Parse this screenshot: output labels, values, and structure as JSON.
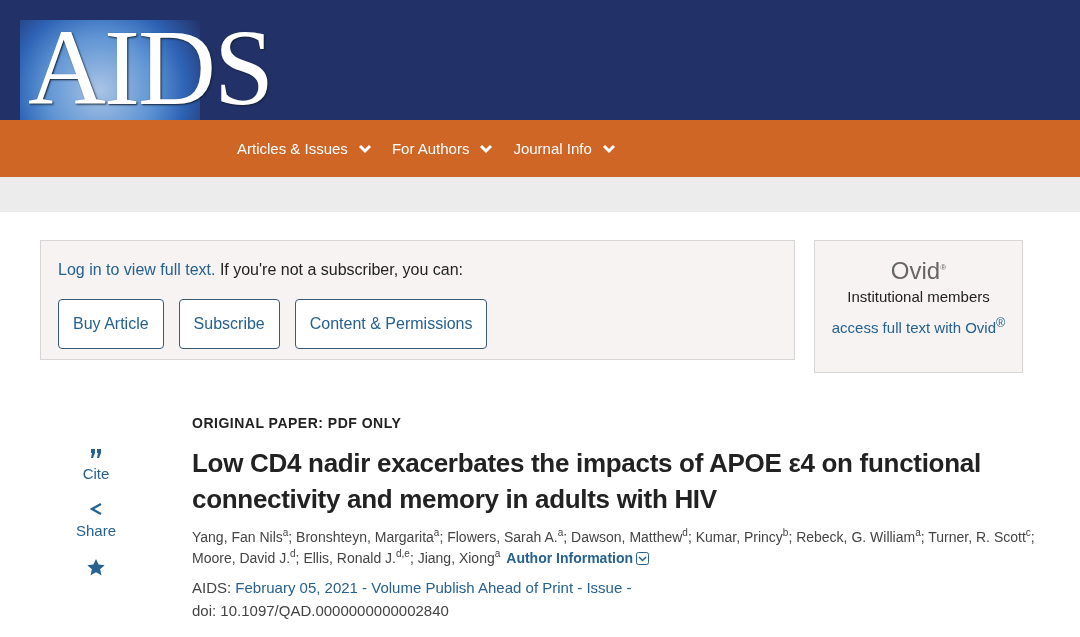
{
  "header": {
    "logo": "AIDS"
  },
  "nav": [
    {
      "label": "Articles & Issues"
    },
    {
      "label": "For Authors"
    },
    {
      "label": "Journal Info"
    }
  ],
  "access": {
    "login_link": "Log in to view full text.",
    "text": "If you're not a subscriber, you can:",
    "buttons": [
      "Buy Article",
      "Subscribe",
      "Content & Permissions"
    ]
  },
  "ovid": {
    "logo": "Ovid",
    "logo_mark": "®",
    "text": "Institutional members",
    "link": "access full text with Ovid$^{®}$"
  },
  "sidebar": [
    {
      "kind": "quote",
      "label": "Cite"
    },
    {
      "kind": "share",
      "label": "Share"
    },
    {
      "kind": "star"
    }
  ],
  "article": {
    "category": "ORIGINAL PAPER: PDF ONLY",
    "title": "Low CD4 nadir exacerbates the impacts of APOE ε4 on functional connectivity and memory in adults with HIV",
    "authors": "Yang, Fan Nils$^{a}$; Bronshteyn, Margarita$^{a}$; Flowers, Sarah A.$^{a}$; Dawson, Matthew$^{d}$; Kumar, Princy$^{b}$; Rebeck, G. William$^{a}$; Turner, R. Scott$^{c}$; Moore, David J.$^{d}$; Ellis, Ronald J.$^{d,e}$; Jiang, Xiong$^{a}$",
    "author_info": "Author Information",
    "journal": "AIDS:",
    "issue_link": "February 05, 2021 - Volume Publish Ahead of Print - Issue -",
    "doi": "doi: 10.1097/QAD.0000000000002840"
  }
}
